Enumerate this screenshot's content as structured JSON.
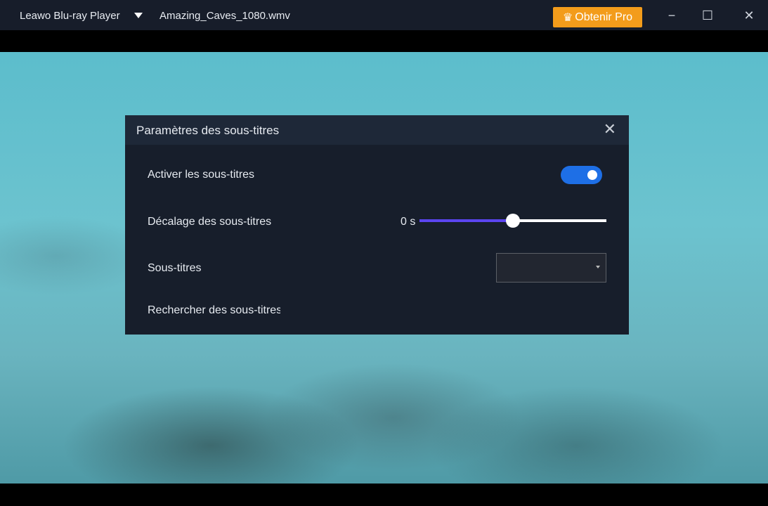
{
  "titlebar": {
    "app_name": "Leawo Blu-ray Player",
    "file_name": "Amazing_Caves_1080.wmv",
    "pro_button": "Obtenir Pro",
    "crown_icon": "♛",
    "minimize": "−",
    "maximize": "☐",
    "close": "✕"
  },
  "dialog": {
    "title": "Paramètres des sous-titres",
    "close": "✕",
    "enable_label": "Activer les sous-titres",
    "enable_on": true,
    "offset_label": "Décalage des sous-titres",
    "offset_value": "0 s",
    "offset_fraction": 0.5,
    "subtitles_label": "Sous-titres",
    "subtitles_selected": "",
    "search_label": "Rechercher des sous-titres"
  },
  "colors": {
    "accent": "#1e6fe6",
    "slider": "#5b45f0",
    "pro": "#f39c1b"
  }
}
